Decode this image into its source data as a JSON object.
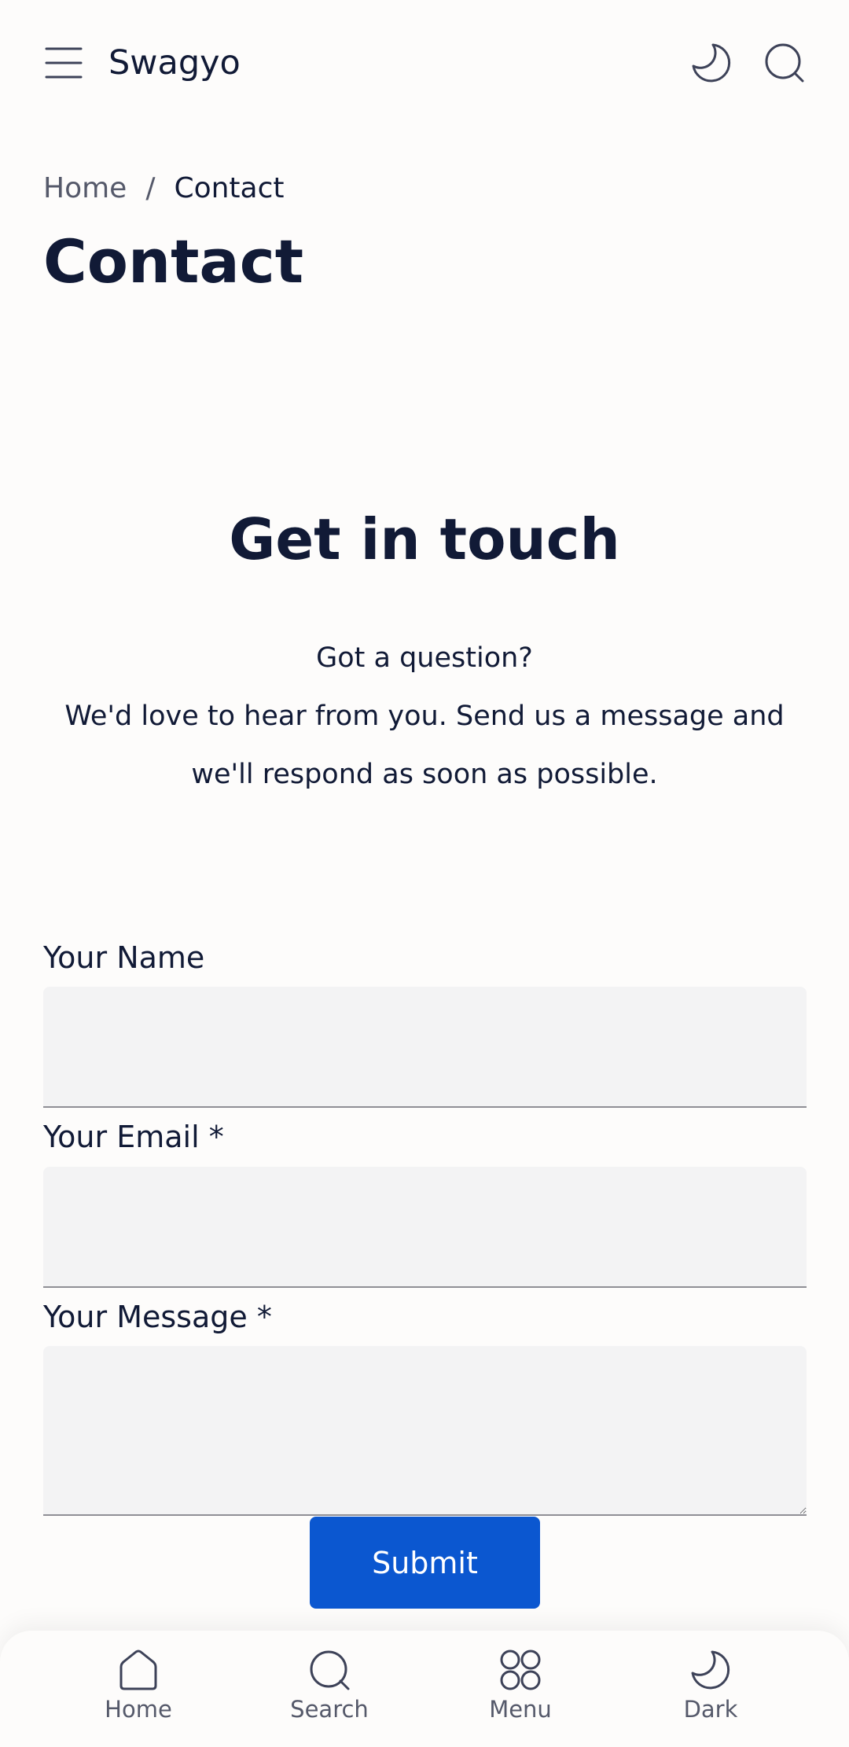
{
  "header": {
    "brand": "Swagyo",
    "menu_icon": "hamburger-menu-icon",
    "theme_icon": "moon-icon",
    "search_icon": "search-icon"
  },
  "breadcrumb": {
    "home": "Home",
    "separator": "/",
    "current": "Contact"
  },
  "page_title": "Contact",
  "section": {
    "title": "Get in touch",
    "line1": "Got a question?",
    "line2": "We'd love to hear from you. Send us a message and we'll respond as soon as possible."
  },
  "form": {
    "name_label": "Your Name",
    "name_value": "",
    "email_label": "Your Email *",
    "email_value": "",
    "message_label": "Your Message *",
    "message_value": "",
    "submit_label": "Submit"
  },
  "bottom_nav": [
    {
      "label": "Home",
      "icon": "home-icon"
    },
    {
      "label": "Search",
      "icon": "search-icon"
    },
    {
      "label": "Menu",
      "icon": "grid-icon"
    },
    {
      "label": "Dark",
      "icon": "moon-icon"
    }
  ],
  "colors": {
    "background": "#fdfcfb",
    "text": "#111a36",
    "muted": "#55596a",
    "field_bg": "#f3f3f4",
    "accent": "#0b57d0"
  }
}
